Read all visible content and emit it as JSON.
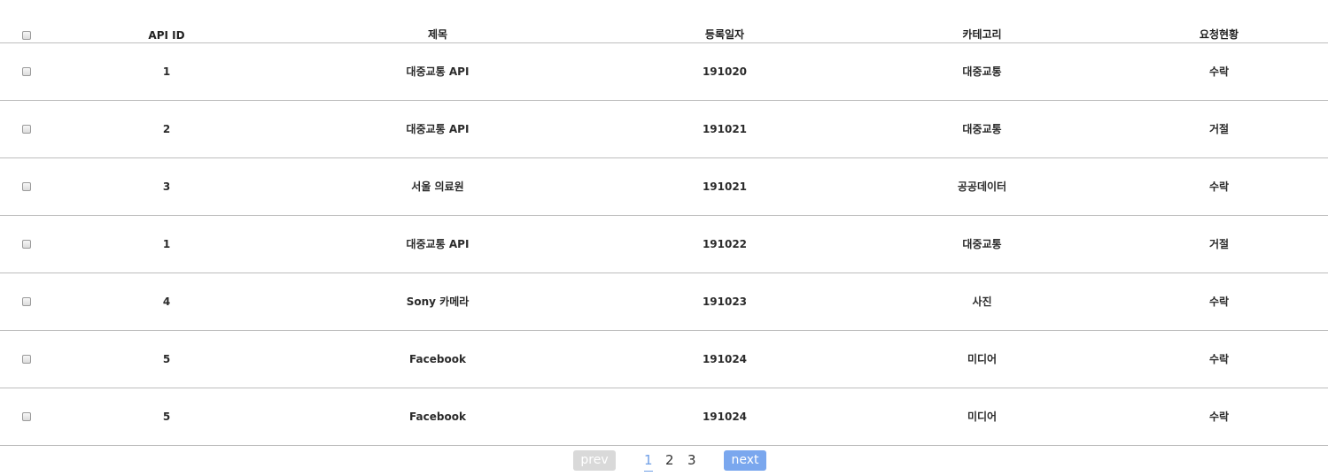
{
  "table": {
    "headers": {
      "api_id": "API ID",
      "title": "제목",
      "date": "등록일자",
      "category": "카테고리",
      "status": "요청현황"
    },
    "rows": [
      {
        "api_id": "1",
        "title": "대중교통 API",
        "date": "191020",
        "category": "대중교통",
        "status": "수락"
      },
      {
        "api_id": "2",
        "title": "대중교통 API",
        "date": "191021",
        "category": "대중교통",
        "status": "거절"
      },
      {
        "api_id": "3",
        "title": "서울 의료원",
        "date": "191021",
        "category": "공공데이터",
        "status": "수락"
      },
      {
        "api_id": "1",
        "title": "대중교통 API",
        "date": "191022",
        "category": "대중교통",
        "status": "거절"
      },
      {
        "api_id": "4",
        "title": "Sony 카메라",
        "date": "191023",
        "category": "사진",
        "status": "수락"
      },
      {
        "api_id": "5",
        "title": "Facebook",
        "date": "191024",
        "category": "미디어",
        "status": "수락"
      },
      {
        "api_id": "5",
        "title": "Facebook",
        "date": "191024",
        "category": "미디어",
        "status": "수락"
      }
    ]
  },
  "pagination": {
    "prev_label": "prev",
    "next_label": "next",
    "pages": [
      "1",
      "2",
      "3"
    ],
    "current_page": "1"
  },
  "colors": {
    "prev_button": "#d9d9d9",
    "next_button": "#7aa7ee",
    "active_page": "#6f9fe6",
    "row_divider": "#bdbdbd"
  }
}
